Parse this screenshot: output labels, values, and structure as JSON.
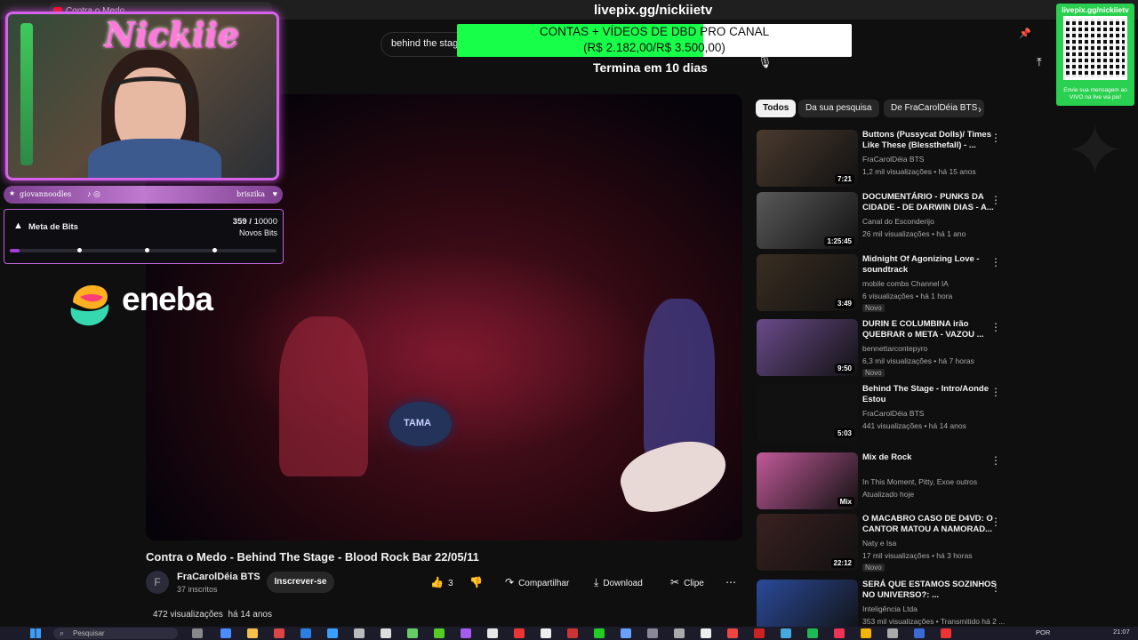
{
  "browser": {
    "tab_title": "Contra o Medo"
  },
  "search": {
    "query": "behind the stage curitiba"
  },
  "video": {
    "title": "Contra o Medo - Behind The Stage - Blood Rock Bar 22/05/11",
    "drum_brand": "TAMA",
    "channel_avatar_letter": "F",
    "channel_name": "FraCarolDéia BTS",
    "subscribers": "37 inscritos",
    "subscribe_label": "Inscrever-se",
    "likes": "3",
    "share_label": "Compartilhar",
    "download_label": "Download",
    "clip_label": "Clipe",
    "views": "472 visualizações",
    "age": "há 14 anos"
  },
  "chips": [
    {
      "label": "Todos"
    },
    {
      "label": "Da sua pesquisa"
    },
    {
      "label": "De FraCarolDéia BTS"
    }
  ],
  "recommendations": [
    {
      "title": "Buttons (Pussycat Dolls)/ Times Like These (Blessthefall) - ...",
      "channel": "FraCarolDéia BTS",
      "meta": "1,2 mil visualizações • há 15 anos",
      "duration": "7:21",
      "badge": "",
      "thumb": "#4a3a2e"
    },
    {
      "title": "DOCUMENTÁRIO - PUNKS DA CIDADE - DE DARWIN DIAS - A...",
      "channel": "Canal do Esconderijo",
      "meta": "26 mil visualizações • há 1 ano",
      "duration": "1:25:45",
      "badge": "",
      "thumb": "#5a5a5a"
    },
    {
      "title": "Midnight Of Agonizing Love - soundtrack",
      "channel": "mobile combs Channel IA",
      "meta": "6 visualizações • há 1 hora",
      "duration": "3:49",
      "badge": "Novo",
      "thumb": "#3a2e22"
    },
    {
      "title": "DURIN E COLUMBINA irão QUEBRAR o META - VAZOU ...",
      "channel": "bennettarcontepyro",
      "meta": "6,3 mil visualizações • há 7 horas",
      "duration": "9:50",
      "badge": "Novo",
      "thumb": "#6a4a8a"
    },
    {
      "title": "Behind The Stage - Intro/Aonde Estou",
      "channel": "FraCarolDéia BTS",
      "meta": "441 visualizações • há 14 anos",
      "duration": "5:03",
      "badge": "",
      "thumb": "#111111"
    },
    {
      "title": "Mix de Rock",
      "channel": "In This Moment, Pitty, Exoe outros",
      "meta": "Atualizado hoje",
      "duration": "Mix",
      "badge": "",
      "thumb": "#c25a9a"
    },
    {
      "title": "O MACABRO CASO DE D4VD: O CANTOR MATOU A NAMORAD...",
      "channel": "Naty e Isa",
      "meta": "17 mil visualizações • há 3 horas",
      "duration": "22:12",
      "badge": "Novo",
      "thumb": "#3a2020"
    },
    {
      "title": "SERÁ QUE ESTAMOS SOZINHOS NO UNIVERSO?: ...",
      "channel": "Inteligência Ltda",
      "meta": "353 mil visualizações • Transmitido há 2 ...",
      "duration": "",
      "badge": "",
      "thumb": "#2a4a9a"
    }
  ],
  "overlay": {
    "streamer_logo": "Nickiie",
    "social_left": "giovannoodles",
    "social_right": "briszika",
    "bits": {
      "title": "Meta de Bits",
      "current": "359",
      "total": "10000",
      "subtitle": "Novos Bits",
      "progress_fraction": 0.036
    },
    "sponsor": "eneba",
    "donation_url": "livepix.gg/nickiietv",
    "goal_line1": "CONTAS + VÍDEOS DE DBD PRO CANAL",
    "goal_line2": "(R$ 2.182,00/R$ 3.500,00)",
    "goal_fraction": 0.623,
    "goal_ends": "Termina em 10 dias",
    "qr_url": "livepix.gg/nickiietv",
    "qr_caption": "Envie sua mensagem ao VIVO na live via pix!"
  },
  "taskbar": {
    "search_placeholder": "Pesquisar",
    "lang": "POR",
    "time": "21:07"
  },
  "colors": {
    "accent_purple": "#c063d8",
    "goal_green": "#18ff4a",
    "youtube_red": "#ff0000"
  }
}
